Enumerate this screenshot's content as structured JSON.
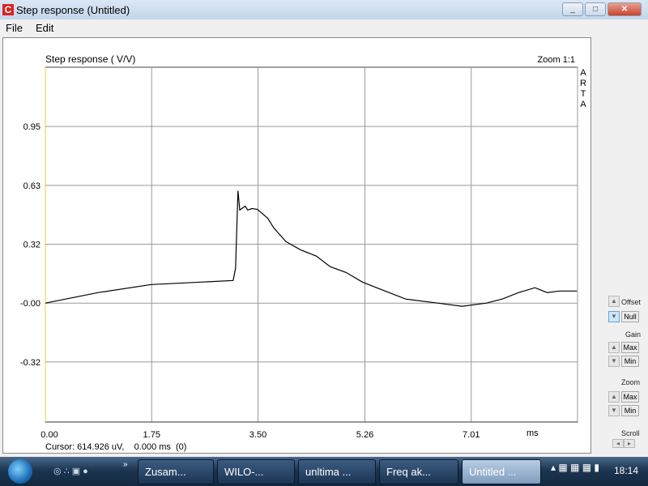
{
  "window": {
    "title": "Step response (Untitled)",
    "icon": "arta-app-icon",
    "controls": [
      "minimize",
      "maximize",
      "close"
    ]
  },
  "menu": [
    "File",
    "Edit"
  ],
  "graph": {
    "title": "Step response ( V/V)",
    "zoom_label": "Zoom 1:1",
    "brand": [
      "A",
      "R",
      "T",
      "A"
    ],
    "cursor_text": "Cursor: 614.926 uV,    0.000 ms  (0)",
    "x_unit": "ms"
  },
  "chart_data": {
    "type": "line",
    "title": "Step response ( V/V)",
    "xlabel": "ms",
    "ylabel": "V/V",
    "xlim": [
      0,
      8.76
    ],
    "ylim": [
      -0.64,
      1.27
    ],
    "grid": true,
    "x_ticks": [
      {
        "value": 0,
        "label": "0.00"
      },
      {
        "value": 1.75,
        "label": "1.75"
      },
      {
        "value": 3.5,
        "label": "3.50"
      },
      {
        "value": 5.26,
        "label": "5.26"
      },
      {
        "value": 7.01,
        "label": "7.01"
      }
    ],
    "y_ticks": [
      {
        "value": 0.951,
        "label": "0.95"
      },
      {
        "value": 0.634,
        "label": "0.63"
      },
      {
        "value": 0.317,
        "label": "0.32"
      },
      {
        "value": 0,
        "label": "-0.00"
      },
      {
        "value": -0.317,
        "label": "-0.32"
      }
    ],
    "series": [
      {
        "name": "Step response",
        "color": "#000000",
        "x": [
          0,
          0.87,
          1.74,
          3.09,
          3.13,
          3.17,
          3.2,
          3.29,
          3.33,
          3.4,
          3.49,
          3.66,
          3.76,
          3.96,
          4.2,
          4.46,
          4.69,
          4.95,
          5.22,
          5.49,
          5.93,
          6.46,
          6.86,
          7.26,
          7.52,
          7.79,
          8.06,
          8.26,
          8.46,
          8.75
        ],
        "y": [
          0,
          0.057,
          0.1,
          0.122,
          0.187,
          0.605,
          0.501,
          0.522,
          0.501,
          0.509,
          0.505,
          0.457,
          0.405,
          0.331,
          0.287,
          0.253,
          0.196,
          0.165,
          0.113,
          0.078,
          0.022,
          0.0,
          -0.017,
          0.0,
          0.022,
          0.057,
          0.083,
          0.057,
          0.065,
          0.065
        ]
      }
    ]
  },
  "side": {
    "offset_label": "Offset",
    "null_label": "Null",
    "gain_label": "Gain",
    "gain_max": "Max",
    "gain_min": "Min",
    "zoom_label": "Zoom",
    "zoom_max": "Max",
    "zoom_min": "Min",
    "scroll_label": "Scroll"
  },
  "taskbar": {
    "buttons": [
      {
        "label": "Zusam..."
      },
      {
        "label": "WILO-..."
      },
      {
        "label": "unltima ..."
      },
      {
        "label": "Freq ak..."
      },
      {
        "label": "Untitled ..."
      }
    ],
    "clock": "18:14"
  }
}
